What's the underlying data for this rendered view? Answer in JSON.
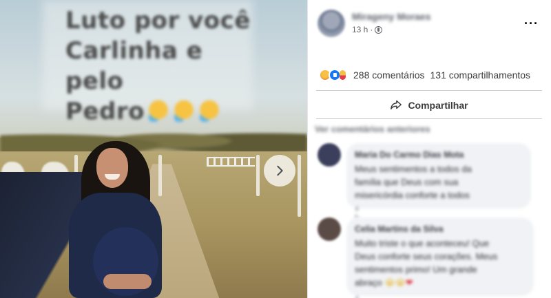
{
  "photo": {
    "caption_lines": [
      "Luto por você",
      "Carlinha e pelo",
      "Pedro"
    ],
    "caption_emoji": [
      "😭",
      "😭",
      "😭"
    ],
    "next_icon": "chevron-right-icon"
  },
  "post": {
    "author": "Mirageny Moraes",
    "time": "13 h",
    "separator": "·",
    "privacy_icon": "globe-icon",
    "more_label": "···",
    "reaction_icons": [
      "angry-icon",
      "like-icon",
      "care-icon"
    ],
    "comments_count": "288 comentários",
    "shares_count": "131 compartilhamentos",
    "share_label": "Compartilhar"
  },
  "comments_section": {
    "view_previous": "Ver comentários anteriores",
    "comments": [
      {
        "name": "Maria Do Carmo Dias Mota",
        "text_lines": [
          "Meus sentimentos a todos da",
          "família que Deus com sua",
          "misericórdia conforte a todos"
        ],
        "time": "4 h",
        "avatar_color": "#3b3f5c"
      },
      {
        "name": "Celia Martins da Silva",
        "text_lines": [
          "Muito triste o que aconteceu! Que",
          "Deus conforte seus corações. Meus",
          "sentimentos primo! Um grande",
          "abraço "
        ],
        "end_emoji": [
          "😭",
          "😭",
          "❤"
        ],
        "time": "4 h",
        "avatar_color": "#5b4b47"
      }
    ]
  }
}
